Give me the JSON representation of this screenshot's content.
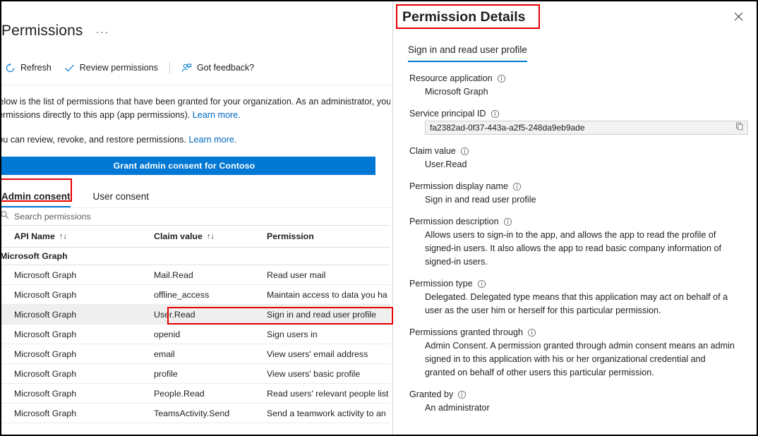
{
  "left_panel": {
    "title": "Permissions",
    "more_label": "···",
    "commands": [
      {
        "label": "Refresh",
        "icon": "refresh-icon"
      },
      {
        "label": "Review permissions",
        "icon": "checkmark-icon"
      },
      {
        "label": "Got feedback?",
        "icon": "feedback-person-icon"
      }
    ],
    "description": {
      "line1_pre": "Below is the list of permissions that have been granted for your organization. As an administrator, you can",
      "line2_pre": "permissions directly to this app (app permissions). ",
      "line2_link": "Learn more.",
      "line3_pre": "You can review, revoke, and restore permissions. ",
      "line3_link": "Learn more."
    },
    "grant_banner": "Grant admin consent for Contoso",
    "tabs": [
      {
        "label": "Admin consent",
        "selected": true
      },
      {
        "label": "User consent",
        "selected": false
      }
    ],
    "search": {
      "placeholder": "Search permissions",
      "value": "",
      "icon": "search-icon"
    },
    "table": {
      "columns": [
        {
          "label": "API Name",
          "sortable": true,
          "sort_icon": "sort-updown-icon"
        },
        {
          "label": "Claim value",
          "sortable": true,
          "sort_icon": "sort-updown-icon"
        },
        {
          "label": "Permission",
          "sortable": false
        }
      ],
      "group_header": "Microsoft Graph",
      "rows": [
        {
          "api": "Microsoft Graph",
          "claim": "Mail.Read",
          "permission": "Read user mail",
          "selected": false
        },
        {
          "api": "Microsoft Graph",
          "claim": "offline_access",
          "permission": "Maintain access to data you ha",
          "selected": false
        },
        {
          "api": "Microsoft Graph",
          "claim": "User.Read",
          "permission": "Sign in and read user profile",
          "selected": true
        },
        {
          "api": "Microsoft Graph",
          "claim": "openid",
          "permission": "Sign users in",
          "selected": false
        },
        {
          "api": "Microsoft Graph",
          "claim": "email",
          "permission": "View users' email address",
          "selected": false
        },
        {
          "api": "Microsoft Graph",
          "claim": "profile",
          "permission": "View users' basic profile",
          "selected": false
        },
        {
          "api": "Microsoft Graph",
          "claim": "People.Read",
          "permission": "Read users' relevant people list",
          "selected": false
        },
        {
          "api": "Microsoft Graph",
          "claim": "TeamsActivity.Send",
          "permission": "Send a teamwork activity to an",
          "selected": false
        }
      ]
    }
  },
  "right_panel": {
    "title": "Permission Details",
    "close_icon": "close-icon",
    "pivot": "Sign in and read user profile",
    "fields": [
      {
        "label": "Resource application",
        "value": "Microsoft Graph",
        "type": "text",
        "info_icon": "info-icon"
      },
      {
        "label": "Service principal ID",
        "value": "fa2382ad-0f37-443a-a2f5-248da9eb9ade",
        "type": "copy",
        "info_icon": "info-icon",
        "copy_icon": "copy-icon"
      },
      {
        "label": "Claim value",
        "value": "User.Read",
        "type": "text",
        "info_icon": "info-icon"
      },
      {
        "label": "Permission display name",
        "value": "Sign in and read user profile",
        "type": "text",
        "info_icon": "info-icon"
      },
      {
        "label": "Permission description",
        "value": "Allows users to sign-in to the app, and allows the app to read the profile of signed-in users. It also allows the app to read basic company information of signed-in users.",
        "type": "text",
        "info_icon": "info-icon"
      },
      {
        "label": "Permission type",
        "value": "Delegated. Delegated type means that this application may act on behalf of a user as the user him or herself for this particular permission.",
        "type": "text",
        "info_icon": "info-icon"
      },
      {
        "label": "Permissions granted through",
        "value": "Admin Consent. A permission granted through admin consent means an admin signed in to this application with his or her organizational credential and granted on behalf of other users this particular permission.",
        "type": "text",
        "info_icon": "info-icon"
      },
      {
        "label": "Granted by",
        "value": "An administrator",
        "type": "text",
        "info_icon": "info-icon"
      }
    ]
  },
  "annotations": {
    "boxes": [
      {
        "name": "admin-consent-highlight",
        "color": "#e60000"
      },
      {
        "name": "user-read-row-highlight",
        "color": "#e60000"
      },
      {
        "name": "permission-details-title-highlight",
        "color": "#e60000"
      }
    ]
  },
  "colors": {
    "accent": "#0078d4",
    "link": "#0066c0",
    "text": "#201f1e",
    "subtle": "#605e5c",
    "row_selected": "#efefef",
    "annotation": "#e60000"
  }
}
